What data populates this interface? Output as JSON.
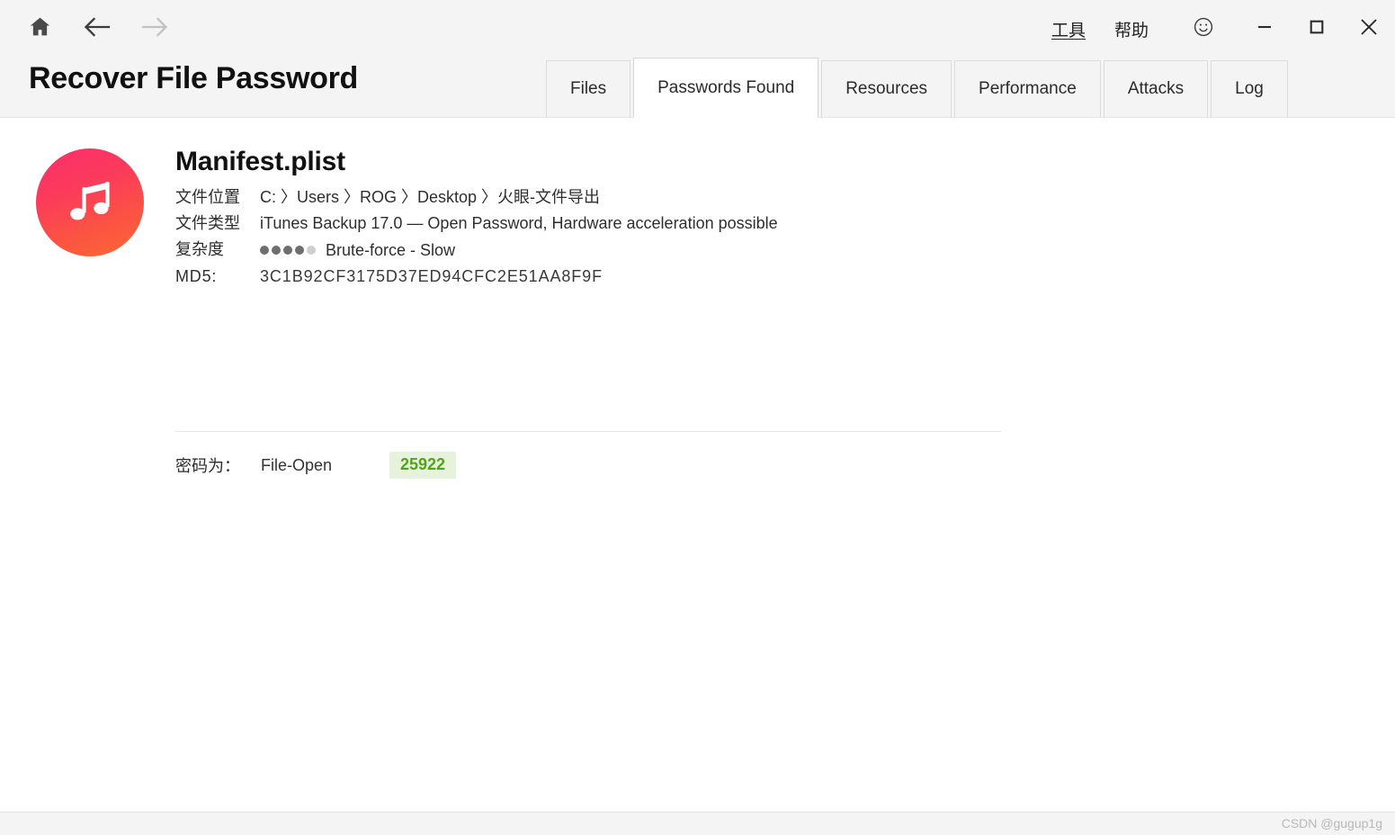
{
  "window": {
    "app_title": "Recover File Password",
    "nav": [
      {
        "name": "home",
        "icon": "home-icon",
        "state": "enabled"
      },
      {
        "name": "back",
        "icon": "arrow-left-icon",
        "state": "enabled"
      },
      {
        "name": "forward",
        "icon": "arrow-right-icon",
        "state": "disabled"
      }
    ],
    "menus": [
      {
        "label": "工具",
        "underlined": true
      },
      {
        "label": "帮助",
        "underlined": false
      }
    ],
    "controls": [
      {
        "name": "feedback",
        "icon": "smiley-icon"
      },
      {
        "name": "minimize",
        "icon": "minimize-icon"
      },
      {
        "name": "maximize",
        "icon": "maximize-icon"
      },
      {
        "name": "close",
        "icon": "close-icon"
      }
    ]
  },
  "tabs": [
    {
      "label": "Files",
      "active": false
    },
    {
      "label": "Passwords Found",
      "active": true
    },
    {
      "label": "Resources",
      "active": false
    },
    {
      "label": "Performance",
      "active": false
    },
    {
      "label": "Attacks",
      "active": false
    },
    {
      "label": "Log",
      "active": false
    }
  ],
  "file": {
    "icon": "itunes-music-note-icon",
    "name": "Manifest.plist",
    "location_label": "文件位置",
    "location_value": "C: 〉Users 〉ROG 〉Desktop 〉火眼-文件导出",
    "type_label": "文件类型",
    "type_value": "iTunes Backup 17.0 — Open Password, Hardware acceleration possible",
    "complexity_label": "复杂度",
    "complexity_value": "Brute-force - Slow",
    "complexity_filled": 4,
    "complexity_total": 5,
    "md5_label": "MD5:",
    "md5_value": "3C1B92CF3175D37ED94CFC2E51AA8F9F"
  },
  "password": {
    "label": "密码为：",
    "kind": "File-Open",
    "value": "25922"
  },
  "footer": {
    "watermark": "CSDN @gugup1g"
  },
  "colors": {
    "header_bg": "#f4f4f4",
    "content_bg": "#ffffff",
    "accent_green_text": "#53a318",
    "accent_green_bg": "#e7f2dc",
    "icon_gradient_start": "#fc2e6a",
    "icon_gradient_end": "#fc6a33",
    "dot_on": "#6e6e6e",
    "dot_off": "#cfcfcf"
  }
}
